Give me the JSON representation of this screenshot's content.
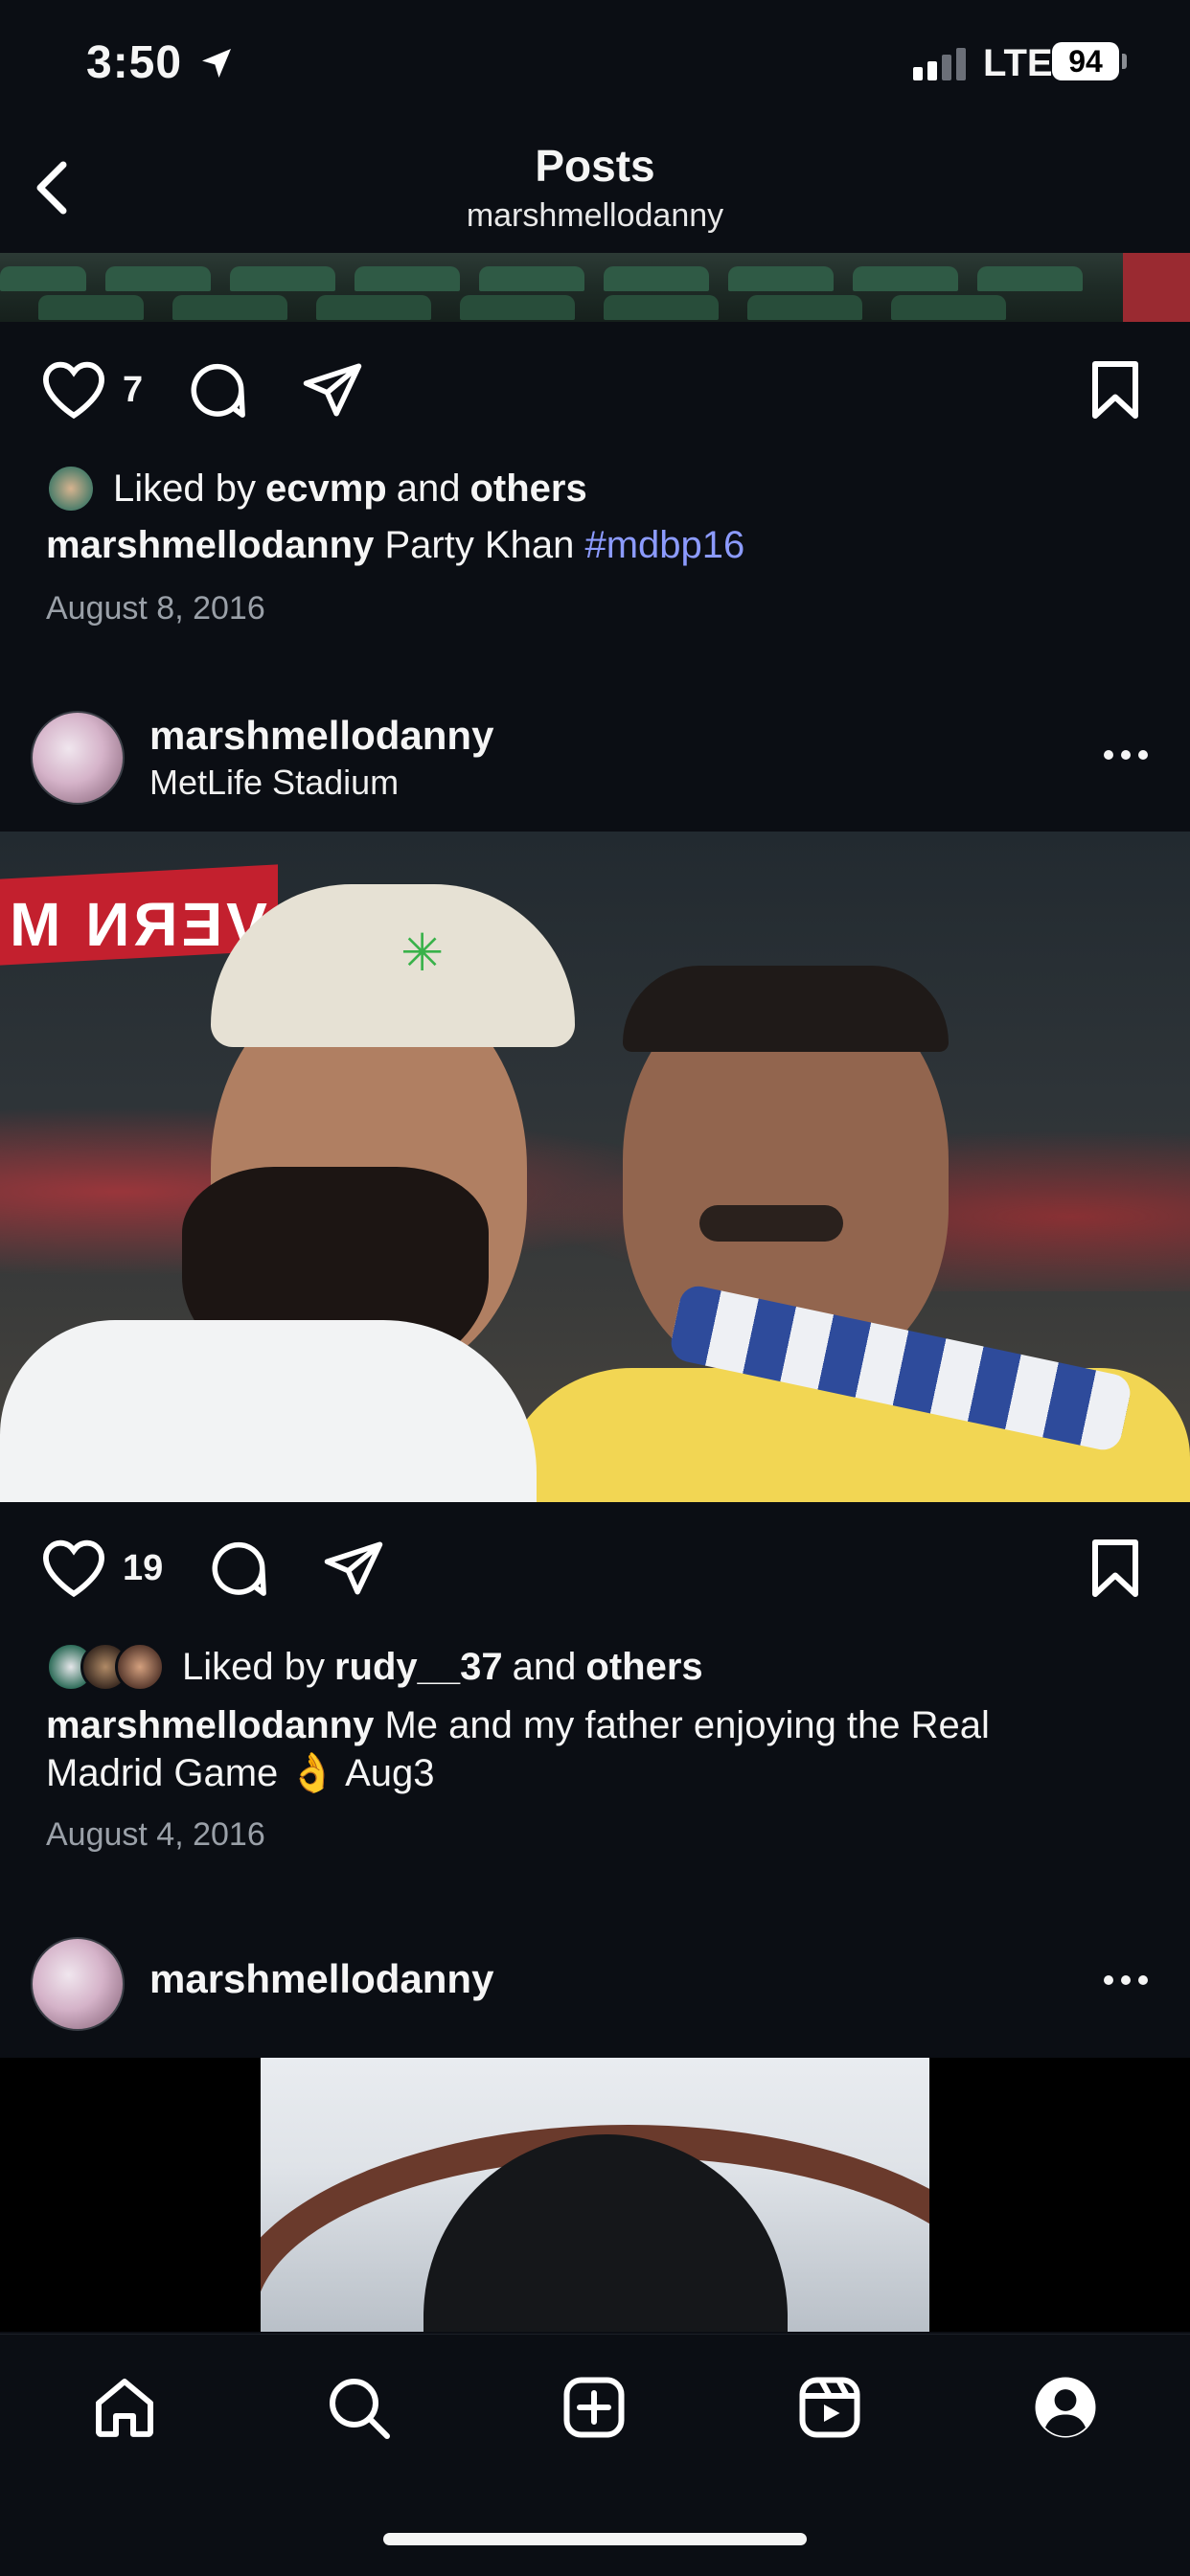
{
  "status_bar": {
    "time": "3:50",
    "network": "LTE",
    "battery": "94"
  },
  "header": {
    "title": "Posts",
    "subtitle": "marshmellodanny"
  },
  "post1": {
    "likes_count": "7",
    "liked_by_prefix": "Liked by",
    "liked_by_user": "ecvmp",
    "liked_by_and": "and",
    "liked_by_others": "others",
    "caption_user": "marshmellodanny",
    "caption_text": "Party Khan",
    "hashtag": "#mdbp16",
    "date": "August 8, 2016"
  },
  "post2": {
    "username": "marshmellodanny",
    "location": "MetLife Stadium",
    "likes_count": "19",
    "liked_by_prefix": "Liked by",
    "liked_by_user": "rudy__37",
    "liked_by_and": "and",
    "liked_by_others": "others",
    "caption_user": "marshmellodanny",
    "caption_text": "Me and my father enjoying the Real Madrid Game 👌 Aug3",
    "date": "August 4, 2016",
    "banner_text": "VERN M"
  },
  "post3": {
    "username": "marshmellodanny"
  },
  "tabs": [
    "home-icon",
    "search-icon",
    "create-icon",
    "reels-icon",
    "profile-icon"
  ],
  "colors": {
    "background": "#0b0e14",
    "hashtag": "#8c9bff",
    "date": "#9aa0a8"
  }
}
